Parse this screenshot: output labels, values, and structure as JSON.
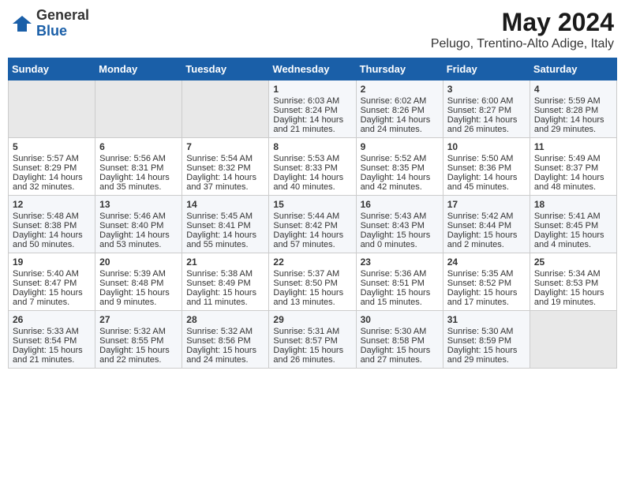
{
  "logo": {
    "general": "General",
    "blue": "Blue"
  },
  "title": {
    "month_year": "May 2024",
    "location": "Pelugo, Trentino-Alto Adige, Italy"
  },
  "headers": [
    "Sunday",
    "Monday",
    "Tuesday",
    "Wednesday",
    "Thursday",
    "Friday",
    "Saturday"
  ],
  "weeks": [
    [
      {
        "day": "",
        "text": ""
      },
      {
        "day": "",
        "text": ""
      },
      {
        "day": "",
        "text": ""
      },
      {
        "day": "1",
        "text": "Sunrise: 6:03 AM\nSunset: 8:24 PM\nDaylight: 14 hours and 21 minutes."
      },
      {
        "day": "2",
        "text": "Sunrise: 6:02 AM\nSunset: 8:26 PM\nDaylight: 14 hours and 24 minutes."
      },
      {
        "day": "3",
        "text": "Sunrise: 6:00 AM\nSunset: 8:27 PM\nDaylight: 14 hours and 26 minutes."
      },
      {
        "day": "4",
        "text": "Sunrise: 5:59 AM\nSunset: 8:28 PM\nDaylight: 14 hours and 29 minutes."
      }
    ],
    [
      {
        "day": "5",
        "text": "Sunrise: 5:57 AM\nSunset: 8:29 PM\nDaylight: 14 hours and 32 minutes."
      },
      {
        "day": "6",
        "text": "Sunrise: 5:56 AM\nSunset: 8:31 PM\nDaylight: 14 hours and 35 minutes."
      },
      {
        "day": "7",
        "text": "Sunrise: 5:54 AM\nSunset: 8:32 PM\nDaylight: 14 hours and 37 minutes."
      },
      {
        "day": "8",
        "text": "Sunrise: 5:53 AM\nSunset: 8:33 PM\nDaylight: 14 hours and 40 minutes."
      },
      {
        "day": "9",
        "text": "Sunrise: 5:52 AM\nSunset: 8:35 PM\nDaylight: 14 hours and 42 minutes."
      },
      {
        "day": "10",
        "text": "Sunrise: 5:50 AM\nSunset: 8:36 PM\nDaylight: 14 hours and 45 minutes."
      },
      {
        "day": "11",
        "text": "Sunrise: 5:49 AM\nSunset: 8:37 PM\nDaylight: 14 hours and 48 minutes."
      }
    ],
    [
      {
        "day": "12",
        "text": "Sunrise: 5:48 AM\nSunset: 8:38 PM\nDaylight: 14 hours and 50 minutes."
      },
      {
        "day": "13",
        "text": "Sunrise: 5:46 AM\nSunset: 8:40 PM\nDaylight: 14 hours and 53 minutes."
      },
      {
        "day": "14",
        "text": "Sunrise: 5:45 AM\nSunset: 8:41 PM\nDaylight: 14 hours and 55 minutes."
      },
      {
        "day": "15",
        "text": "Sunrise: 5:44 AM\nSunset: 8:42 PM\nDaylight: 14 hours and 57 minutes."
      },
      {
        "day": "16",
        "text": "Sunrise: 5:43 AM\nSunset: 8:43 PM\nDaylight: 15 hours and 0 minutes."
      },
      {
        "day": "17",
        "text": "Sunrise: 5:42 AM\nSunset: 8:44 PM\nDaylight: 15 hours and 2 minutes."
      },
      {
        "day": "18",
        "text": "Sunrise: 5:41 AM\nSunset: 8:45 PM\nDaylight: 15 hours and 4 minutes."
      }
    ],
    [
      {
        "day": "19",
        "text": "Sunrise: 5:40 AM\nSunset: 8:47 PM\nDaylight: 15 hours and 7 minutes."
      },
      {
        "day": "20",
        "text": "Sunrise: 5:39 AM\nSunset: 8:48 PM\nDaylight: 15 hours and 9 minutes."
      },
      {
        "day": "21",
        "text": "Sunrise: 5:38 AM\nSunset: 8:49 PM\nDaylight: 15 hours and 11 minutes."
      },
      {
        "day": "22",
        "text": "Sunrise: 5:37 AM\nSunset: 8:50 PM\nDaylight: 15 hours and 13 minutes."
      },
      {
        "day": "23",
        "text": "Sunrise: 5:36 AM\nSunset: 8:51 PM\nDaylight: 15 hours and 15 minutes."
      },
      {
        "day": "24",
        "text": "Sunrise: 5:35 AM\nSunset: 8:52 PM\nDaylight: 15 hours and 17 minutes."
      },
      {
        "day": "25",
        "text": "Sunrise: 5:34 AM\nSunset: 8:53 PM\nDaylight: 15 hours and 19 minutes."
      }
    ],
    [
      {
        "day": "26",
        "text": "Sunrise: 5:33 AM\nSunset: 8:54 PM\nDaylight: 15 hours and 21 minutes."
      },
      {
        "day": "27",
        "text": "Sunrise: 5:32 AM\nSunset: 8:55 PM\nDaylight: 15 hours and 22 minutes."
      },
      {
        "day": "28",
        "text": "Sunrise: 5:32 AM\nSunset: 8:56 PM\nDaylight: 15 hours and 24 minutes."
      },
      {
        "day": "29",
        "text": "Sunrise: 5:31 AM\nSunset: 8:57 PM\nDaylight: 15 hours and 26 minutes."
      },
      {
        "day": "30",
        "text": "Sunrise: 5:30 AM\nSunset: 8:58 PM\nDaylight: 15 hours and 27 minutes."
      },
      {
        "day": "31",
        "text": "Sunrise: 5:30 AM\nSunset: 8:59 PM\nDaylight: 15 hours and 29 minutes."
      },
      {
        "day": "",
        "text": ""
      }
    ]
  ]
}
